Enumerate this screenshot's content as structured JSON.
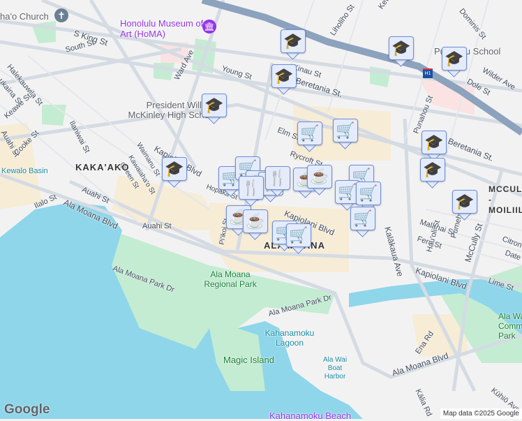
{
  "labels": {
    "church": "ha'o Church",
    "museum": "Honolulu Museum of Art (HoMA)",
    "s_king": "S King St",
    "south": "South St",
    "young": "Young St",
    "ward": "Ward Ave",
    "halekauwila": "Halekauwila St",
    "kukaina": "ukaina St",
    "keawe": "Keawe St",
    "auahi_w": "Auahi St",
    "cooke": "Cooke St",
    "ilaniwai": "Ilaniwai St",
    "mckinley": "President William McKinley High School",
    "kapiolani_w": "Kapiolani Blvd",
    "waimanu": "Waimanu St",
    "kawaiahao": "Kawaiaha'o St",
    "queen": "Queen St",
    "kakaako": "KAKA'AKO",
    "kewalo": "Kewalo Basin",
    "auahi": "Auahi St",
    "auahi2": "Auahi St",
    "ilalo": "Ilalo St",
    "ala_moana_blvd_w": "Ala Moana Blvd",
    "hopaka": "Hopaka St",
    "piikoi": "Pi'ikoi St",
    "ala_moana_park_dr": "Ala Moana Park Dr",
    "ala_moana_park": "Ala Moana Regional Park",
    "ala_moana_park_dr2": "Ala Moana Park Dr",
    "ala_moana": "ALA MOANA",
    "kapiolani_center": "Kapiolani Blvd",
    "kinau": "Kinau St",
    "beretania": "Beretania St.",
    "liholiho": "Liholiho St",
    "kewalo_st": "Kewalo St",
    "dominis": "Dominis St",
    "punahou_school": "Punahou School",
    "wilder": "Wilder Ave",
    "dole": "Dole St",
    "punahou": "Punahou St",
    "s_beretania": "S Beretania St.",
    "elm": "Elm St",
    "rycroft": "Rycroft St",
    "kalakaua": "Kalākaua Ave",
    "mccully_moiliili": "MCCULLY - MOILIILI",
    "malanai": "Malanai St",
    "fern": "Fern St",
    "hauoli": "Hau'oli St",
    "pumehana": "Pumehana St",
    "mccully": "McCully St",
    "citron": "Citron St",
    "date": "Date St",
    "lime": "Lime St",
    "kapiolani_e": "Kapiolani Blvd",
    "kahanamoku_lagoon": "Kahanamoku Lagoon",
    "magic_island": "Magic Island",
    "boat_harbor": "Ala Wai Boat Harbor",
    "ala_moana_blvd_e": "Ala Moana Blvd",
    "ena": "Ena Rd",
    "kalia": "Kālia Rd",
    "kuhio": "Kūhiō Ave",
    "ala_wai_park": "Ala Wai Community Park",
    "kahanamoku_beach": "Kahanamoku Beach",
    "h1": "H1"
  },
  "markers": [
    {
      "type": "school",
      "icon": "graduation-cap-icon"
    },
    {
      "type": "school",
      "icon": "graduation-cap-icon"
    },
    {
      "type": "school",
      "icon": "graduation-cap-icon"
    },
    {
      "type": "school",
      "icon": "graduation-cap-icon"
    },
    {
      "type": "school",
      "icon": "graduation-cap-icon"
    },
    {
      "type": "school",
      "icon": "graduation-cap-icon"
    },
    {
      "type": "school",
      "icon": "graduation-cap-icon"
    },
    {
      "type": "school",
      "icon": "graduation-cap-icon"
    },
    {
      "type": "school",
      "icon": "graduation-cap-icon"
    },
    {
      "type": "grocery",
      "icon": "shopping-cart-icon"
    },
    {
      "type": "grocery",
      "icon": "shopping-cart-icon"
    },
    {
      "type": "grocery",
      "icon": "shopping-cart-icon"
    },
    {
      "type": "grocery",
      "icon": "shopping-cart-icon"
    },
    {
      "type": "grocery",
      "icon": "shopping-cart-icon"
    },
    {
      "type": "grocery",
      "icon": "shopping-cart-icon"
    },
    {
      "type": "grocery",
      "icon": "shopping-cart-icon"
    },
    {
      "type": "grocery",
      "icon": "shopping-cart-icon"
    },
    {
      "type": "grocery",
      "icon": "shopping-cart-icon"
    },
    {
      "type": "grocery",
      "icon": "shopping-cart-icon"
    },
    {
      "type": "restaurant",
      "icon": "fork-knife-icon"
    },
    {
      "type": "restaurant",
      "icon": "fork-knife-icon"
    },
    {
      "type": "restaurant",
      "icon": "fork-knife-icon"
    },
    {
      "type": "restaurant",
      "icon": "fork-knife-icon"
    },
    {
      "type": "cafe",
      "icon": "coffee-cup-icon"
    },
    {
      "type": "cafe",
      "icon": "coffee-cup-icon"
    },
    {
      "type": "cafe",
      "icon": "coffee-cup-icon"
    },
    {
      "type": "cafe",
      "icon": "coffee-cup-icon"
    }
  ],
  "footer": {
    "logo": "Google",
    "attribution": "Map data ©2025 Google"
  },
  "colors": {
    "water": "#8fd6ea",
    "park": "#c4ecd2",
    "highway": "#8ca2bd",
    "road": "#d5dbe3",
    "shopping": "#f7ecd6",
    "marker_bg": "#e4ebfb",
    "marker_icon": "#0b3a5c"
  }
}
